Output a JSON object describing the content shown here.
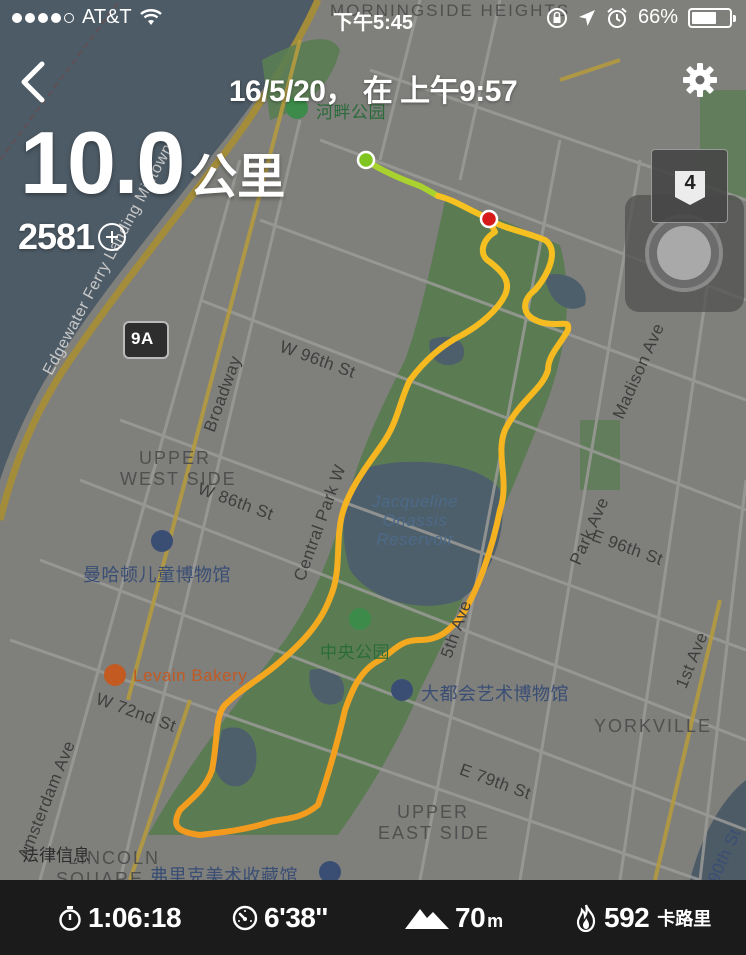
{
  "status_bar": {
    "carrier": "AT&T",
    "time": "下午5:45",
    "battery_percent": "66%",
    "battery_level": 0.66
  },
  "header": {
    "date": "16/5/20， 在 上午9:57"
  },
  "summary": {
    "distance_value": "10.0",
    "distance_unit": "公里",
    "score": "2581"
  },
  "map_controls": {
    "layer_badge": "4"
  },
  "map": {
    "labels": {
      "heights": "MORNINGSIDE HEIGHTS",
      "riverside_park": "河畔公园",
      "edgewater": "Edgewater Ferry Landing Midtown",
      "highway": "9A",
      "w96": "W 96th St",
      "broadway": "Broadway",
      "upper_west_line1": "UPPER",
      "upper_west_line2": "WEST SIDE",
      "w86": "W 86th St",
      "central_park_w": "Central Park W",
      "childrens_museum": "曼哈顿儿童博物馆",
      "reservoir_line1": "Jacqueline",
      "reservoir_line2": "Onassis",
      "reservoir_line3": "Reservoir",
      "central_park": "中央公园",
      "levain": "Levain Bakery",
      "met_museum": "大都会艺术博物馆",
      "w72": "W 72nd St",
      "amsterdam": "Amsterdam Ave",
      "fifth_ave": "5th Ave",
      "madison": "Madison Ave",
      "park_ave": "Park Ave",
      "e96": "E 96th St",
      "first_ave": "1st Ave",
      "yorkville": "YORKVILLE",
      "e79": "E 79th St",
      "upper_east_line1": "UPPER",
      "upper_east_line2": "EAST SIDE",
      "lincoln_line1": "LINCOLN",
      "lincoln_line2": "SQUARE",
      "frick": "弗里克美术收藏馆",
      "ninetieth": "90th St",
      "legal": "法律信息"
    }
  },
  "stats": {
    "duration": "1:06:18",
    "pace": "6'38''",
    "elevation": "70",
    "elevation_unit": "m",
    "calories": "592",
    "calories_unit": "卡路里"
  },
  "colors": {
    "route_start": "#f7c221",
    "route_end": "#f39a1e",
    "start_marker": "#7fc41f",
    "end_marker": "#d61a1a",
    "park": "#5a7d52",
    "water": "#4d5b66",
    "bar": "#1b1b1b"
  },
  "icons": {
    "back": "chevron-left-icon",
    "settings": "gear-icon",
    "duration": "stopwatch-icon",
    "pace": "speedometer-icon",
    "elevation": "mountain-icon",
    "calories": "flame-icon"
  }
}
